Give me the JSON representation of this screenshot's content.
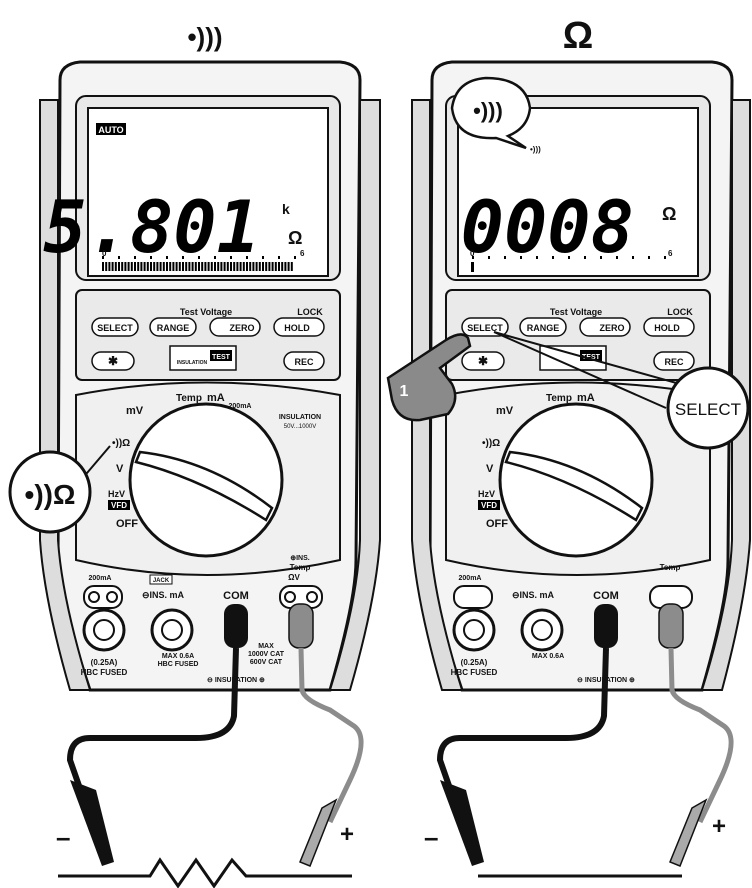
{
  "headers": {
    "left_symbol": "•)))",
    "right_symbol": "Ω"
  },
  "meter_left": {
    "lcd": {
      "auto_label": "AUTO",
      "reading": "5.801",
      "unit_prefix": "k",
      "unit": "Ω",
      "bar_start": "0",
      "bar_end": "6"
    },
    "buttons": {
      "select": "SELECT",
      "range": "RANGE",
      "zero": "ZERO",
      "hold": "HOLD",
      "lock": "LOCK",
      "test_voltage": "Test Voltage",
      "rec": "REC",
      "test": "TEST",
      "insulation": "INSULATION"
    },
    "dial": {
      "mv": "mV",
      "temp": "Temp",
      "ma": "mA",
      "ma200": "200mA",
      "insulation": "INSULATION",
      "ins_range": "50V...1000V",
      "ohm": "•))Ω",
      "vac": "V",
      "hzv": "HzV",
      "vfd": "VFD",
      "off": "OFF"
    },
    "jacks": {
      "ma200": "200mA",
      "jack": "JACK",
      "ins_ma": "⊖INS. mA",
      "com": "COM",
      "ins": "⊕INS.",
      "temp": "Temp",
      "sym": "ΩV",
      "fuse_a": "(0.25A)",
      "fuse_a2": "HBC FUSED",
      "max_a": "MAX 0.6A",
      "max_a2": "HBC FUSED",
      "max_v": "MAX",
      "max_v2": "1000V CAT",
      "max_v3": "600V CAT",
      "insulation": "⊖ INSULATION ⊕"
    },
    "callout": "•))Ω"
  },
  "meter_right": {
    "lcd": {
      "reading": "0008",
      "unit": "Ω",
      "bar_start": "0",
      "bar_end": "6",
      "bubble": "•)))",
      "small_beep": "•)))"
    },
    "callout": "SELECT",
    "step": "1"
  },
  "probes": {
    "minus": "–",
    "plus": "+"
  },
  "colors": {
    "ink": "#111111",
    "body": "#f2f2f2",
    "lcd": "#ffffff",
    "probe_red": "#8c8c8c",
    "probe_black": "#111111"
  }
}
